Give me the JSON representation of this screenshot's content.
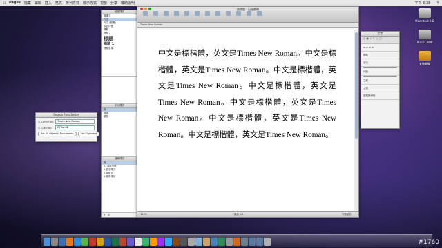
{
  "menubar": {
    "items": [
      "Pages",
      "檔案",
      "編輯",
      "插入",
      "格式",
      "排列方式",
      "顯示方式",
      "視窗",
      "分享",
      "輔助說明"
    ],
    "clock": "下午 6:38"
  },
  "document": {
    "window_title": "無標題 - 已經編輯",
    "format_bar_font": "Times New Roman",
    "body_text": "中文是標楷體，英文是Times New Roman。中文是標楷體，英文是Times New Roman。中文是標楷體，英文是Times New Roman。中文是標楷體，英文是Times New Roman。中文是標楷體，英文是Times New Roman。中文是標楷體，英文是Times New Roman。中文是標楷體，英文是Times New Roman。",
    "status_left": "125%",
    "status_center": "頁面 1/1",
    "status_right": "字數統計"
  },
  "styles_drawer": {
    "title": "段落樣式",
    "items": [
      "無樣式",
      "內文",
      "內文 (粗體)",
      "項目符號",
      "標題 1",
      "標題 2",
      "標題",
      "標題 1",
      "標題名稱"
    ],
    "char_title": "字元樣式",
    "char_items": [
      "無",
      "強調",
      "重點"
    ],
    "list_title": "清單樣式",
    "list_items": [
      "無",
      "1. 項目符號",
      "1.數字樣式",
      "1.階層式",
      "1.圖像項目"
    ]
  },
  "inspector": {
    "title": "文字",
    "rows": [
      "顏色",
      "字元",
      "行距",
      "之前",
      "之後",
      "邊框與線段"
    ]
  },
  "font_dialog": {
    "title": "Region Font Setter",
    "latin_label": "Latin Font",
    "latin_value": "Times New Roman",
    "cjk_label": "CJK Font",
    "cjk_value": "DFKai-SB",
    "btn_set_all": "Set All Objects' Documents",
    "btn_clipboard": "Set Clipboard"
  },
  "desktop": {
    "icons": [
      "Macintosh HD",
      "BOOTCAMP",
      "安裝磁碟"
    ]
  },
  "watermark": "#1760",
  "colors": {
    "selection": "#b8cde6",
    "scroll_thumb": "#a9b9cc"
  }
}
